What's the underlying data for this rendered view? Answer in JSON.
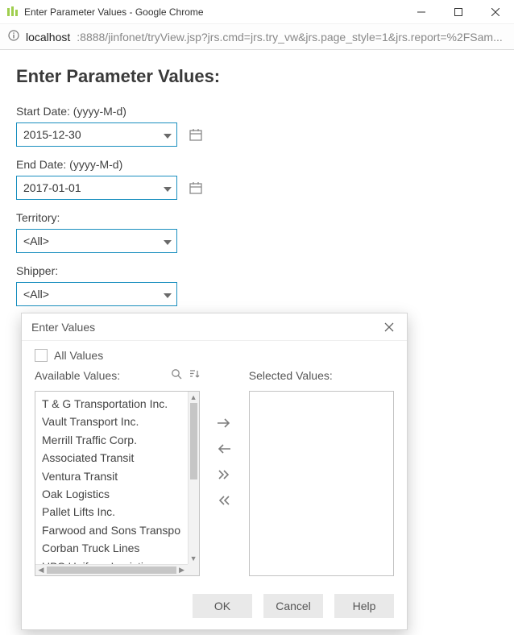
{
  "window": {
    "title": "Enter Parameter Values - Google Chrome"
  },
  "url": {
    "host": "localhost",
    "rest": ":8888/jinfonet/tryView.jsp?jrs.cmd=jrs.try_vw&jrs.page_style=1&jrs.report=%2FSam..."
  },
  "page": {
    "heading": "Enter Parameter Values:"
  },
  "params": {
    "start_date": {
      "label": "Start Date: (yyyy-M-d)",
      "value": "2015-12-30"
    },
    "end_date": {
      "label": "End Date: (yyyy-M-d)",
      "value": "2017-01-01"
    },
    "territory": {
      "label": "Territory:",
      "value": "<All>"
    },
    "shipper": {
      "label": "Shipper:",
      "value": "<All>"
    }
  },
  "popup": {
    "title": "Enter Values",
    "all_values_label": "All Values",
    "available_label": "Available Values:",
    "selected_label": "Selected Values:",
    "available_items": [
      "T & G Transportation Inc.",
      "Vault Transport Inc.",
      "Merrill Traffic Corp.",
      "Associated Transit",
      "Ventura Transit",
      "Oak Logistics",
      "Pallet Lifts Inc.",
      "Farwood and Sons Transport",
      "Corban Truck Lines",
      "UBS Uniform Logistics"
    ],
    "selected_items": [],
    "buttons": {
      "ok": "OK",
      "cancel": "Cancel",
      "help": "Help"
    }
  }
}
